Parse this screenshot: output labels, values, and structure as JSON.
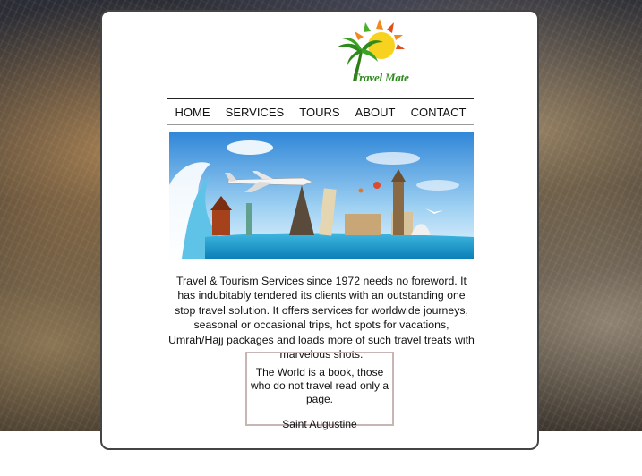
{
  "brand": {
    "name": "Travel Mate"
  },
  "nav": {
    "items": [
      "HOME",
      "SERVICES",
      "TOURS",
      "ABOUT",
      "CONTACT"
    ]
  },
  "intro": "Travel & Tourism Services since 1972 needs no foreword. It has indubitably tendered its clients with an outstanding one stop travel solution. It offers services for worldwide journeys, seasonal or occasional trips, hot spots for vacations, Umrah/Hajj packages and loads more of such travel treats with marvelous shots.",
  "quote": {
    "text": "The World is a book, those who do not travel read only a page.",
    "author": "Saint Augustine"
  },
  "colors": {
    "logo_green": "#2e8a1e",
    "sun_yellow": "#f7d21e",
    "sun_orange": "#f08a1c",
    "panel_border": "#444444",
    "quote_border": "#c8b5b5"
  }
}
